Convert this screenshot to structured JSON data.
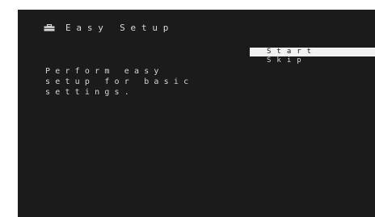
{
  "header": {
    "icon": "toolbox-icon",
    "title": "Easy Setup"
  },
  "description": "Perform easy\nsetup for basic\nsettings.",
  "menu": {
    "items": [
      {
        "label": "Start",
        "selected": true
      },
      {
        "label": "Skip",
        "selected": false
      }
    ]
  },
  "colors": {
    "background": "#1b1b1b",
    "text": "#d9d9d9",
    "highlight": "#f2f2f2"
  }
}
